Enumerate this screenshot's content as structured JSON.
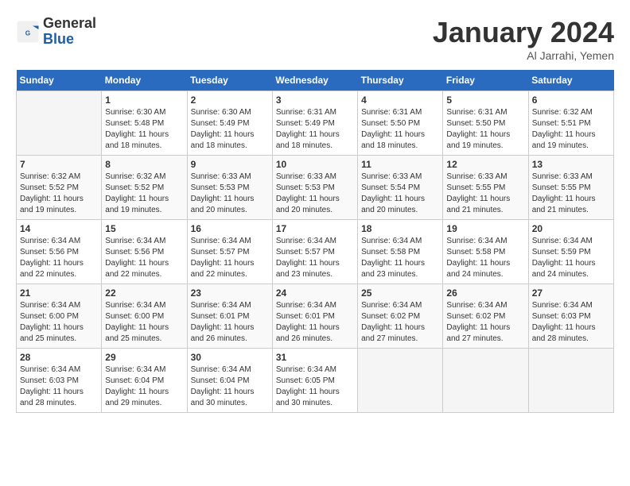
{
  "header": {
    "logo_line1": "General",
    "logo_line2": "Blue",
    "month": "January 2024",
    "location": "Al Jarrahi, Yemen"
  },
  "days_of_week": [
    "Sunday",
    "Monday",
    "Tuesday",
    "Wednesday",
    "Thursday",
    "Friday",
    "Saturday"
  ],
  "weeks": [
    [
      {
        "day": "",
        "info": ""
      },
      {
        "day": "1",
        "info": "Sunrise: 6:30 AM\nSunset: 5:48 PM\nDaylight: 11 hours\nand 18 minutes."
      },
      {
        "day": "2",
        "info": "Sunrise: 6:30 AM\nSunset: 5:49 PM\nDaylight: 11 hours\nand 18 minutes."
      },
      {
        "day": "3",
        "info": "Sunrise: 6:31 AM\nSunset: 5:49 PM\nDaylight: 11 hours\nand 18 minutes."
      },
      {
        "day": "4",
        "info": "Sunrise: 6:31 AM\nSunset: 5:50 PM\nDaylight: 11 hours\nand 18 minutes."
      },
      {
        "day": "5",
        "info": "Sunrise: 6:31 AM\nSunset: 5:50 PM\nDaylight: 11 hours\nand 19 minutes."
      },
      {
        "day": "6",
        "info": "Sunrise: 6:32 AM\nSunset: 5:51 PM\nDaylight: 11 hours\nand 19 minutes."
      }
    ],
    [
      {
        "day": "7",
        "info": "Sunrise: 6:32 AM\nSunset: 5:52 PM\nDaylight: 11 hours\nand 19 minutes."
      },
      {
        "day": "8",
        "info": "Sunrise: 6:32 AM\nSunset: 5:52 PM\nDaylight: 11 hours\nand 19 minutes."
      },
      {
        "day": "9",
        "info": "Sunrise: 6:33 AM\nSunset: 5:53 PM\nDaylight: 11 hours\nand 20 minutes."
      },
      {
        "day": "10",
        "info": "Sunrise: 6:33 AM\nSunset: 5:53 PM\nDaylight: 11 hours\nand 20 minutes."
      },
      {
        "day": "11",
        "info": "Sunrise: 6:33 AM\nSunset: 5:54 PM\nDaylight: 11 hours\nand 20 minutes."
      },
      {
        "day": "12",
        "info": "Sunrise: 6:33 AM\nSunset: 5:55 PM\nDaylight: 11 hours\nand 21 minutes."
      },
      {
        "day": "13",
        "info": "Sunrise: 6:33 AM\nSunset: 5:55 PM\nDaylight: 11 hours\nand 21 minutes."
      }
    ],
    [
      {
        "day": "14",
        "info": "Sunrise: 6:34 AM\nSunset: 5:56 PM\nDaylight: 11 hours\nand 22 minutes."
      },
      {
        "day": "15",
        "info": "Sunrise: 6:34 AM\nSunset: 5:56 PM\nDaylight: 11 hours\nand 22 minutes."
      },
      {
        "day": "16",
        "info": "Sunrise: 6:34 AM\nSunset: 5:57 PM\nDaylight: 11 hours\nand 22 minutes."
      },
      {
        "day": "17",
        "info": "Sunrise: 6:34 AM\nSunset: 5:57 PM\nDaylight: 11 hours\nand 23 minutes."
      },
      {
        "day": "18",
        "info": "Sunrise: 6:34 AM\nSunset: 5:58 PM\nDaylight: 11 hours\nand 23 minutes."
      },
      {
        "day": "19",
        "info": "Sunrise: 6:34 AM\nSunset: 5:58 PM\nDaylight: 11 hours\nand 24 minutes."
      },
      {
        "day": "20",
        "info": "Sunrise: 6:34 AM\nSunset: 5:59 PM\nDaylight: 11 hours\nand 24 minutes."
      }
    ],
    [
      {
        "day": "21",
        "info": "Sunrise: 6:34 AM\nSunset: 6:00 PM\nDaylight: 11 hours\nand 25 minutes."
      },
      {
        "day": "22",
        "info": "Sunrise: 6:34 AM\nSunset: 6:00 PM\nDaylight: 11 hours\nand 25 minutes."
      },
      {
        "day": "23",
        "info": "Sunrise: 6:34 AM\nSunset: 6:01 PM\nDaylight: 11 hours\nand 26 minutes."
      },
      {
        "day": "24",
        "info": "Sunrise: 6:34 AM\nSunset: 6:01 PM\nDaylight: 11 hours\nand 26 minutes."
      },
      {
        "day": "25",
        "info": "Sunrise: 6:34 AM\nSunset: 6:02 PM\nDaylight: 11 hours\nand 27 minutes."
      },
      {
        "day": "26",
        "info": "Sunrise: 6:34 AM\nSunset: 6:02 PM\nDaylight: 11 hours\nand 27 minutes."
      },
      {
        "day": "27",
        "info": "Sunrise: 6:34 AM\nSunset: 6:03 PM\nDaylight: 11 hours\nand 28 minutes."
      }
    ],
    [
      {
        "day": "28",
        "info": "Sunrise: 6:34 AM\nSunset: 6:03 PM\nDaylight: 11 hours\nand 28 minutes."
      },
      {
        "day": "29",
        "info": "Sunrise: 6:34 AM\nSunset: 6:04 PM\nDaylight: 11 hours\nand 29 minutes."
      },
      {
        "day": "30",
        "info": "Sunrise: 6:34 AM\nSunset: 6:04 PM\nDaylight: 11 hours\nand 30 minutes."
      },
      {
        "day": "31",
        "info": "Sunrise: 6:34 AM\nSunset: 6:05 PM\nDaylight: 11 hours\nand 30 minutes."
      },
      {
        "day": "",
        "info": ""
      },
      {
        "day": "",
        "info": ""
      },
      {
        "day": "",
        "info": ""
      }
    ]
  ]
}
